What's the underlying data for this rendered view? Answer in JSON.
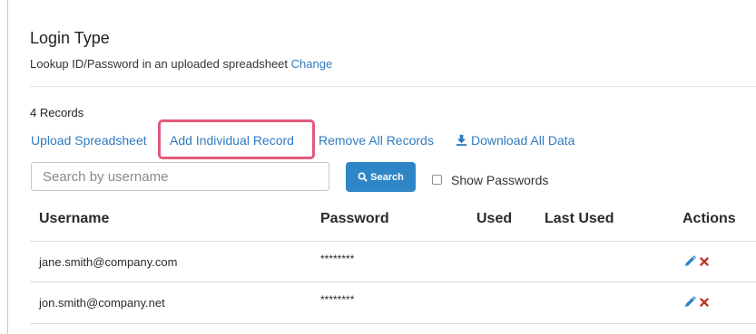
{
  "login": {
    "title": "Login Type",
    "description": "Lookup ID/Password in an uploaded spreadsheet",
    "change_link": "Change"
  },
  "records": {
    "count_label": "4 Records",
    "actions": {
      "upload": "Upload Spreadsheet",
      "add": "Add Individual Record",
      "remove_all": "Remove All Records",
      "download": "Download All Data"
    }
  },
  "search": {
    "placeholder": "Search by username",
    "value": "",
    "button_label": "Search",
    "show_passwords_label": "Show Passwords",
    "show_passwords_checked": false
  },
  "table": {
    "columns": [
      "Username",
      "Password",
      "Used",
      "Last Used",
      "Actions"
    ],
    "rows": [
      {
        "username": "jane.smith@company.com",
        "password": "********",
        "used": "",
        "last_used": ""
      },
      {
        "username": "jon.smith@company.net",
        "password": "********",
        "used": "",
        "last_used": ""
      }
    ]
  },
  "icons": {
    "download": "download-icon",
    "search": "search-icon",
    "edit": "pencil-icon",
    "delete": "close-icon"
  },
  "colors": {
    "link": "#2f7bbf",
    "button": "#2f86c6",
    "highlight": "#e5587c",
    "delete": "#c0392b"
  }
}
